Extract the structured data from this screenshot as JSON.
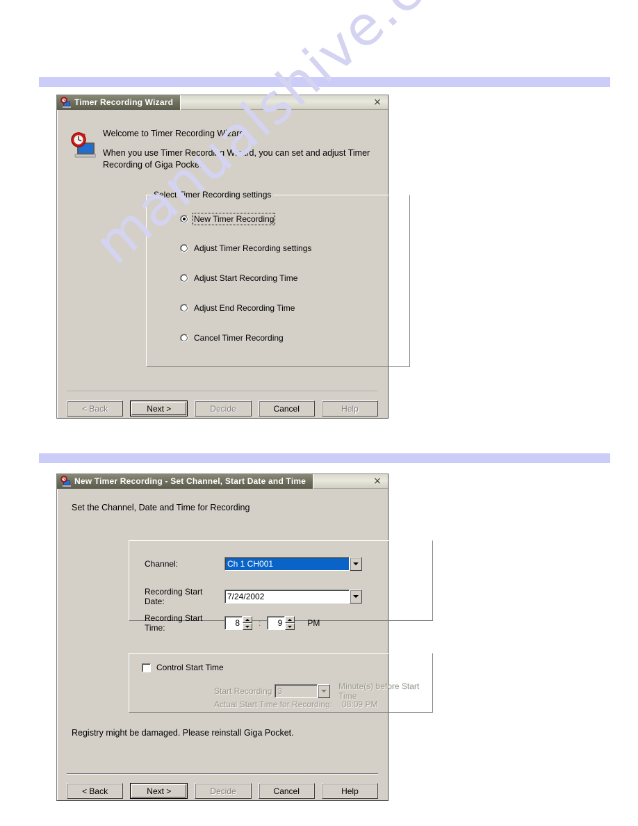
{
  "page": {
    "watermark": "manualshive.com"
  },
  "dialog1": {
    "title": "Timer Recording Wizard",
    "icon": "timer-recording-app-icon",
    "close_label": "×",
    "intro_line1": "Welcome to Timer Recording Wizard",
    "intro_line2": "When you use Timer Recording Wizard, you can set and adjust Timer",
    "intro_line3": "Recording of Giga Pocket.",
    "group_label": "Select Timer Recording settings",
    "options": [
      {
        "label": "New Timer Recording",
        "checked": true
      },
      {
        "label": "Adjust Timer Recording settings",
        "checked": false
      },
      {
        "label": "Adjust Start Recording Time",
        "checked": false
      },
      {
        "label": "Adjust End Recording Time",
        "checked": false
      },
      {
        "label": "Cancel Timer Recording",
        "checked": false
      }
    ],
    "buttons": [
      {
        "label": "< Back",
        "state": "disabled"
      },
      {
        "label": "Next >",
        "state": "default"
      },
      {
        "label": "Decide",
        "state": "disabled"
      },
      {
        "label": "Cancel",
        "state": "enabled"
      },
      {
        "label": "Help",
        "state": "disabled"
      }
    ]
  },
  "dialog2": {
    "title": "New Timer Recording - Set Channel, Start Date and Time",
    "icon": "timer-recording-app-icon",
    "close_label": "×",
    "instruction": "Set the Channel, Date and Time for Recording",
    "fields": {
      "channel_label": "Channel:",
      "channel_value": "Ch 1 CH001",
      "date_label": "Recording Start Date:",
      "date_value": "7/24/2002",
      "time_label": "Recording Start Time:",
      "hour_value": "8",
      "time_separator": ":",
      "minute_value": "9",
      "meridiem": "PM"
    },
    "control_group": {
      "checkbox_label": "Control Start Time",
      "checked": false,
      "start_recording_label": "Start Recording",
      "minutes_value": "3",
      "minutes_suffix": "Minute(s) before Start Time",
      "actual_label": "Actual Start Time for Recording:",
      "actual_value": "08:09 PM"
    },
    "status_message": "Registry might be damaged. Please reinstall Giga Pocket.",
    "buttons": [
      {
        "label": "< Back",
        "state": "enabled"
      },
      {
        "label": "Next >",
        "state": "default"
      },
      {
        "label": "Decide",
        "state": "disabled"
      },
      {
        "label": "Cancel",
        "state": "enabled"
      },
      {
        "label": "Help",
        "state": "enabled"
      }
    ]
  }
}
